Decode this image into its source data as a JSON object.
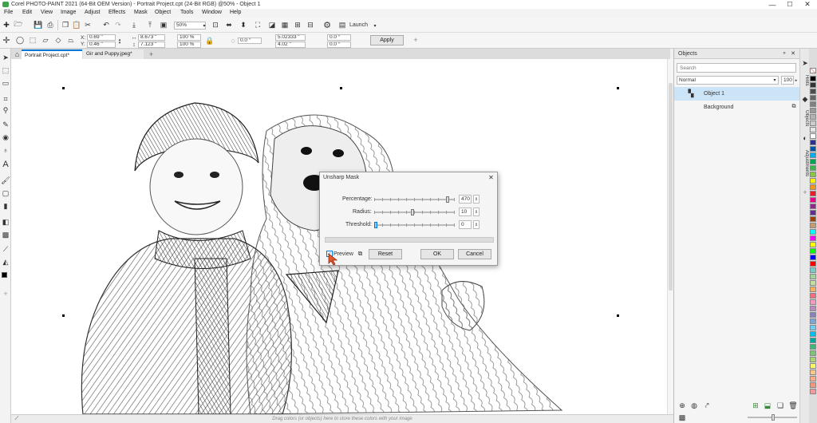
{
  "window": {
    "title": "Corel PHOTO-PAINT 2021 (64-Bit OEM Version) - Portrait Project.cpt (24-Bit RGB) @50% - Object 1",
    "minimize": "—",
    "maximize": "☐",
    "close": "✕"
  },
  "menu": [
    "File",
    "Edit",
    "View",
    "Image",
    "Adjust",
    "Effects",
    "Mask",
    "Object",
    "Tools",
    "Window",
    "Help"
  ],
  "toolbar": {
    "zoom": "50%",
    "launch": "Launch"
  },
  "property_bar": {
    "x_label": "X:",
    "x_value": "0.69 \"",
    "y_label": "Y:",
    "y_value": "0.46 \"",
    "w_value": "8.673 \"",
    "h_value": "7.123 \"",
    "scale_x": "100 %",
    "scale_y": "100 %",
    "angle": "0.0 °",
    "center_x": "5.02333 \"",
    "center_y": "4.02 \"",
    "skew_x": "0.0 °",
    "skew_y": "0.0 °",
    "apply": "Apply",
    "add": "+"
  },
  "doc_tabs": [
    {
      "label": "Portrait Project.cpt*",
      "active": true
    },
    {
      "label": "Gir and Puppy.jpeg*",
      "active": false
    }
  ],
  "tab_add": "+",
  "status": {
    "palette_hint": "Drag colors (or objects) here to store these colors with your image"
  },
  "objects_panel": {
    "title": "Objects",
    "search_placeholder": "Search",
    "blend_mode": "Normal",
    "opacity": "100",
    "items": [
      {
        "name": "Object 1",
        "selected": true
      },
      {
        "name": "Background",
        "selected": false
      }
    ]
  },
  "side_tabs": [
    "Hints",
    "Objects",
    "Adjustments"
  ],
  "palette": {
    "colors": [
      "#000000",
      "#333333",
      "#4d4d4d",
      "#666666",
      "#808080",
      "#999999",
      "#b3b3b3",
      "#cccccc",
      "#e6e6e6",
      "#ffffff",
      "#2e3192",
      "#0054a6",
      "#00aeef",
      "#00a651",
      "#39b54a",
      "#8dc63f",
      "#fff200",
      "#f7941d",
      "#ed1c24",
      "#ec008c",
      "#92278f",
      "#662d91",
      "#a0410d",
      "#c69c6d",
      "#00ffff",
      "#ff00ff",
      "#ffff00",
      "#00ff00",
      "#0000ff",
      "#ff0000",
      "#7accc8",
      "#a3d39c",
      "#c4df9b",
      "#fbaf5d",
      "#f26d7d",
      "#f49ac2",
      "#bd8cbf",
      "#8781bd",
      "#7da7d9",
      "#6dcff6",
      "#00bff3",
      "#00a99d",
      "#3cb878",
      "#7cc576",
      "#acd373",
      "#fff568",
      "#fdc689",
      "#f9ad81",
      "#f69679",
      "#f5989d"
    ]
  },
  "dialog": {
    "title": "Unsharp Mask",
    "close": "✕",
    "percentage_label": "Percentage:",
    "percentage_value": "470",
    "percentage_level": 0.94,
    "radius_label": "Radius:",
    "radius_value": "10",
    "radius_level": 0.48,
    "threshold_label": "Threshold:",
    "threshold_value": "0",
    "threshold_level": 0.0,
    "preview_label": "Preview",
    "reset": "Reset",
    "ok": "OK",
    "cancel": "Cancel"
  },
  "colors": {
    "accent": "#0078d7",
    "selection": "#cce4f7",
    "cursor": "#e8572a"
  }
}
